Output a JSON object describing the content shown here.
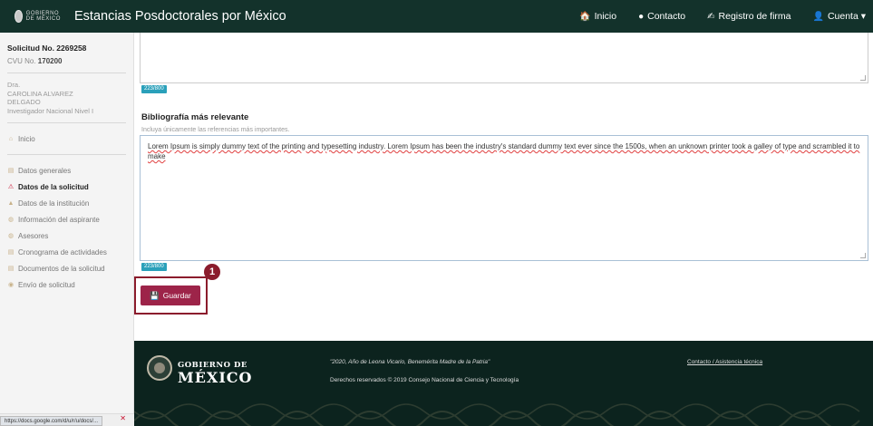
{
  "header": {
    "logo_text": "GOBIERNO DE MÉXICO",
    "title": "Estancias Posdoctorales por México",
    "nav": [
      {
        "icon": "home-icon",
        "glyph": "🏠",
        "label": "Inicio"
      },
      {
        "icon": "chat-icon",
        "glyph": "●",
        "label": "Contacto"
      },
      {
        "icon": "signature-icon",
        "glyph": "✍",
        "label": "Registro de firma"
      },
      {
        "icon": "user-icon",
        "glyph": "👤",
        "label": "Cuenta ▾"
      }
    ]
  },
  "sidebar": {
    "request_number": "Solicitud No. 2269258",
    "cvu_label": "CVU No.",
    "cvu_value": "170200",
    "person": {
      "title": "Dra.",
      "name_line1": "CAROLINA ALVAREZ",
      "name_line2": "DELGADO",
      "level": "Investigador Nacional Nivel I"
    },
    "home_link": "Inicio",
    "items": [
      {
        "label": "Datos generales",
        "icon": "document-icon",
        "glyph": "▤",
        "active": false
      },
      {
        "label": "Datos de la solicitud",
        "icon": "warning-icon",
        "glyph": "⚠",
        "active": true
      },
      {
        "label": "Datos de la institución",
        "icon": "institution-icon",
        "glyph": "▲",
        "active": false
      },
      {
        "label": "Información del aspirante",
        "icon": "people-icon",
        "glyph": "◍",
        "active": false
      },
      {
        "label": "Asesores",
        "icon": "advisors-icon",
        "glyph": "◍",
        "active": false
      },
      {
        "label": "Cronograma de actividades",
        "icon": "calendar-icon",
        "glyph": "▤",
        "active": false
      },
      {
        "label": "Documentos de la solicitud",
        "icon": "file-icon",
        "glyph": "▤",
        "active": false
      },
      {
        "label": "Envío de solicitud",
        "icon": "send-icon",
        "glyph": "◉",
        "active": false
      }
    ],
    "status_url": "https://docs.google.com/d/u/r/u/docs/..."
  },
  "main": {
    "first_counter": "223/800",
    "section_title": "Bibliografía más relevante",
    "section_hint": "Incluya únicamente las referencias más importantes.",
    "bibliography_text": "Lorem Ipsum is simply dummy text of the printing and typesetting industry. Lorem Ipsum has been the industry's standard dummy text ever since the 1500s, when an unknown printer took a galley of type and scrambled it to make",
    "second_counter": "223/800",
    "save_button": "Guardar",
    "step_badge": "1"
  },
  "footer": {
    "gov_line1": "GOBIERNO DE",
    "gov_line2": "MÉXICO",
    "quote": "\"2020, Año de Leona Vicario, Benemérita Madre de la Patria\"",
    "rights": "Derechos reservados © 2019 Consejo Nacional de Ciencia y Tecnología",
    "contact_link": "Contacto / Asistencia técnica"
  },
  "colors": {
    "header_bg": "#13322b",
    "accent": "#9d2449",
    "highlight": "#8b1c2c",
    "counter": "#2aa0ba",
    "footer_bg": "#0c231e"
  }
}
